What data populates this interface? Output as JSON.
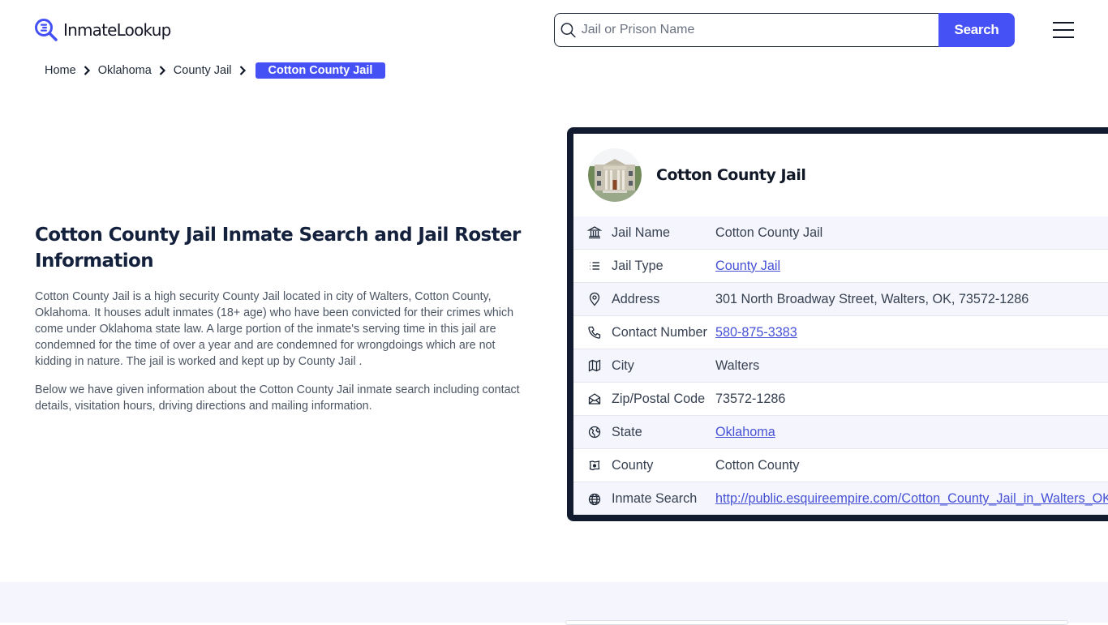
{
  "brand": {
    "name": "InmateLookup",
    "accent": "#4651f5"
  },
  "search": {
    "placeholder": "Jail or Prison Name",
    "value": "",
    "button_label": "Search"
  },
  "breadcrumb": {
    "items": [
      "Home",
      "Oklahoma",
      "County Jail"
    ],
    "current": "Cotton County Jail"
  },
  "intro": {
    "title": "Cotton County Jail Inmate Search and Jail Roster Information",
    "paragraphs": [
      "Cotton County Jail is a high security County Jail located in city of Walters, Cotton County, Oklahoma. It houses adult inmates (18+ age) who have been convicted for their crimes which come under Oklahoma state law. A large portion of the inmate's serving time in this jail are condemned for the time of over a year and are condemned for wrongdoings which are not kidding in nature. The jail is worked and kept up by County Jail .",
      "Below we have given information about the Cotton County Jail inmate search including contact details, visitation hours, driving directions and mailing information."
    ]
  },
  "card": {
    "title": "Cotton County Jail",
    "image_alt": "Cotton County Jail building",
    "rows": [
      {
        "icon": "bank-icon",
        "label": "Jail Name",
        "value": "Cotton County Jail",
        "link": false
      },
      {
        "icon": "list-icon",
        "label": "Jail Type",
        "value": "County Jail",
        "link": true
      },
      {
        "icon": "map-pin-icon",
        "label": "Address",
        "value": "301 North Broadway Street, Walters, OK, 73572-1286",
        "link": false
      },
      {
        "icon": "phone-icon",
        "label": "Contact Number",
        "value": "580-875-3383",
        "link": true
      },
      {
        "icon": "map-icon",
        "label": "City",
        "value": "Walters",
        "link": false
      },
      {
        "icon": "mail-open-icon",
        "label": "Zip/Postal Code",
        "value": "73572-1286",
        "link": false
      },
      {
        "icon": "globe-state-icon",
        "label": "State",
        "value": "Oklahoma",
        "link": true
      },
      {
        "icon": "county-map-icon",
        "label": "County",
        "value": "Cotton County",
        "link": false
      },
      {
        "icon": "world-icon",
        "label": "Inmate Search",
        "value": "http://public.esquireempire.com/Cotton_County_Jail_in_Walters_OK",
        "link": true
      }
    ]
  }
}
